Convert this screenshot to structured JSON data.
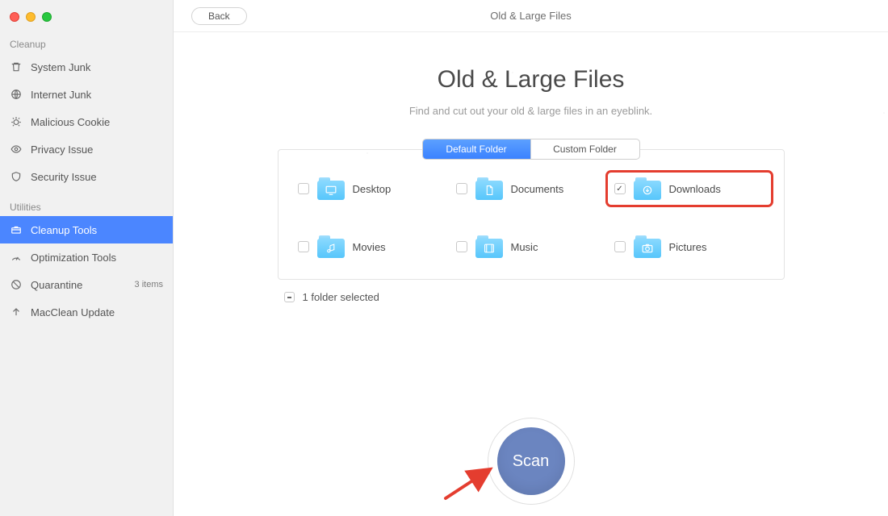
{
  "topbar": {
    "back_label": "Back",
    "title": "Old & Large Files"
  },
  "hero": {
    "title": "Old & Large Files",
    "subtitle": "Find and cut out your old & large files in an eyeblink."
  },
  "sidebar": {
    "sections": [
      {
        "label": "Cleanup",
        "items": [
          {
            "id": "system-junk",
            "label": "System Junk",
            "icon": "trash-icon"
          },
          {
            "id": "internet-junk",
            "label": "Internet Junk",
            "icon": "globe-icon"
          },
          {
            "id": "malicious-cookie",
            "label": "Malicious Cookie",
            "icon": "bug-icon"
          },
          {
            "id": "privacy-issue",
            "label": "Privacy Issue",
            "icon": "eye-icon"
          },
          {
            "id": "security-issue",
            "label": "Security Issue",
            "icon": "shield-icon"
          }
        ]
      },
      {
        "label": "Utilities",
        "items": [
          {
            "id": "cleanup-tools",
            "label": "Cleanup Tools",
            "icon": "toolbox-icon",
            "active": true
          },
          {
            "id": "optimization-tools",
            "label": "Optimization Tools",
            "icon": "gauge-icon"
          },
          {
            "id": "quarantine",
            "label": "Quarantine",
            "icon": "quarantine-icon",
            "badge": "3 items"
          },
          {
            "id": "macclean-update",
            "label": "MacClean Update",
            "icon": "update-icon"
          }
        ]
      }
    ]
  },
  "tabs": {
    "default": "Default Folder",
    "custom": "Custom Folder"
  },
  "folders": [
    {
      "id": "desktop",
      "label": "Desktop",
      "checked": false
    },
    {
      "id": "documents",
      "label": "Documents",
      "checked": false
    },
    {
      "id": "downloads",
      "label": "Downloads",
      "checked": true,
      "highlight": true
    },
    {
      "id": "movies",
      "label": "Movies",
      "checked": false
    },
    {
      "id": "music",
      "label": "Music",
      "checked": false
    },
    {
      "id": "pictures",
      "label": "Pictures",
      "checked": false
    }
  ],
  "summary": {
    "text": "1 folder selected"
  },
  "scan": {
    "label": "Scan"
  },
  "colors": {
    "accent": "#4b86ff",
    "scan": "#6b85c0",
    "highlight": "#e43d2f"
  }
}
